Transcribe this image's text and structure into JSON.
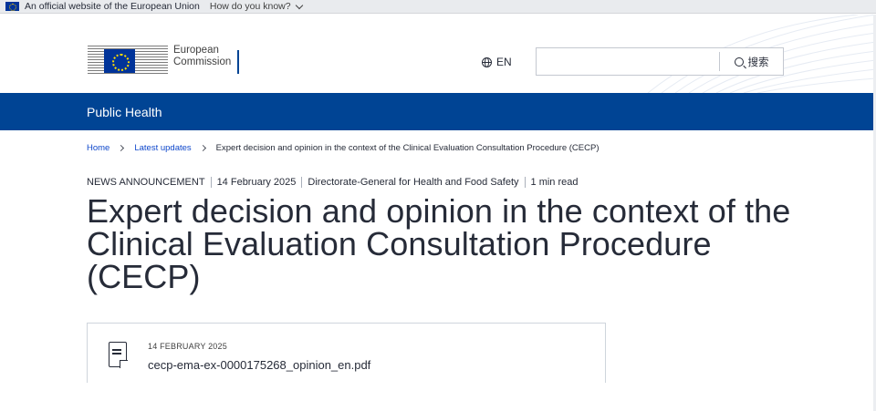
{
  "eu_banner": {
    "official_text": "An official website of the European Union",
    "how_text": "How do you know?"
  },
  "header": {
    "logo_line1": "European",
    "logo_line2": "Commission",
    "language": "EN",
    "search_placeholder": "",
    "search_button": "搜索"
  },
  "site": {
    "name": "Public Health"
  },
  "breadcrumb": {
    "items": [
      {
        "label": "Home"
      },
      {
        "label": "Latest updates"
      },
      {
        "label": "Expert decision and opinion in the context of the Clinical Evaluation Consultation Procedure (CECP)"
      }
    ]
  },
  "meta": {
    "type": "NEWS ANNOUNCEMENT",
    "date": "14 February 2025",
    "department": "Directorate-General for Health and Food Safety",
    "read_time": "1 min read"
  },
  "page": {
    "title": "Expert decision and opinion in the context of the Clinical Evaluation Consultation Procedure (CECP)"
  },
  "file": {
    "date": "14 FEBRUARY 2025",
    "name": "cecp-ema-ex-0000175268_opinion_en.pdf"
  },
  "colors": {
    "brand_blue": "#004494",
    "link_blue": "#0e47cb",
    "text_dark": "#262b38"
  }
}
